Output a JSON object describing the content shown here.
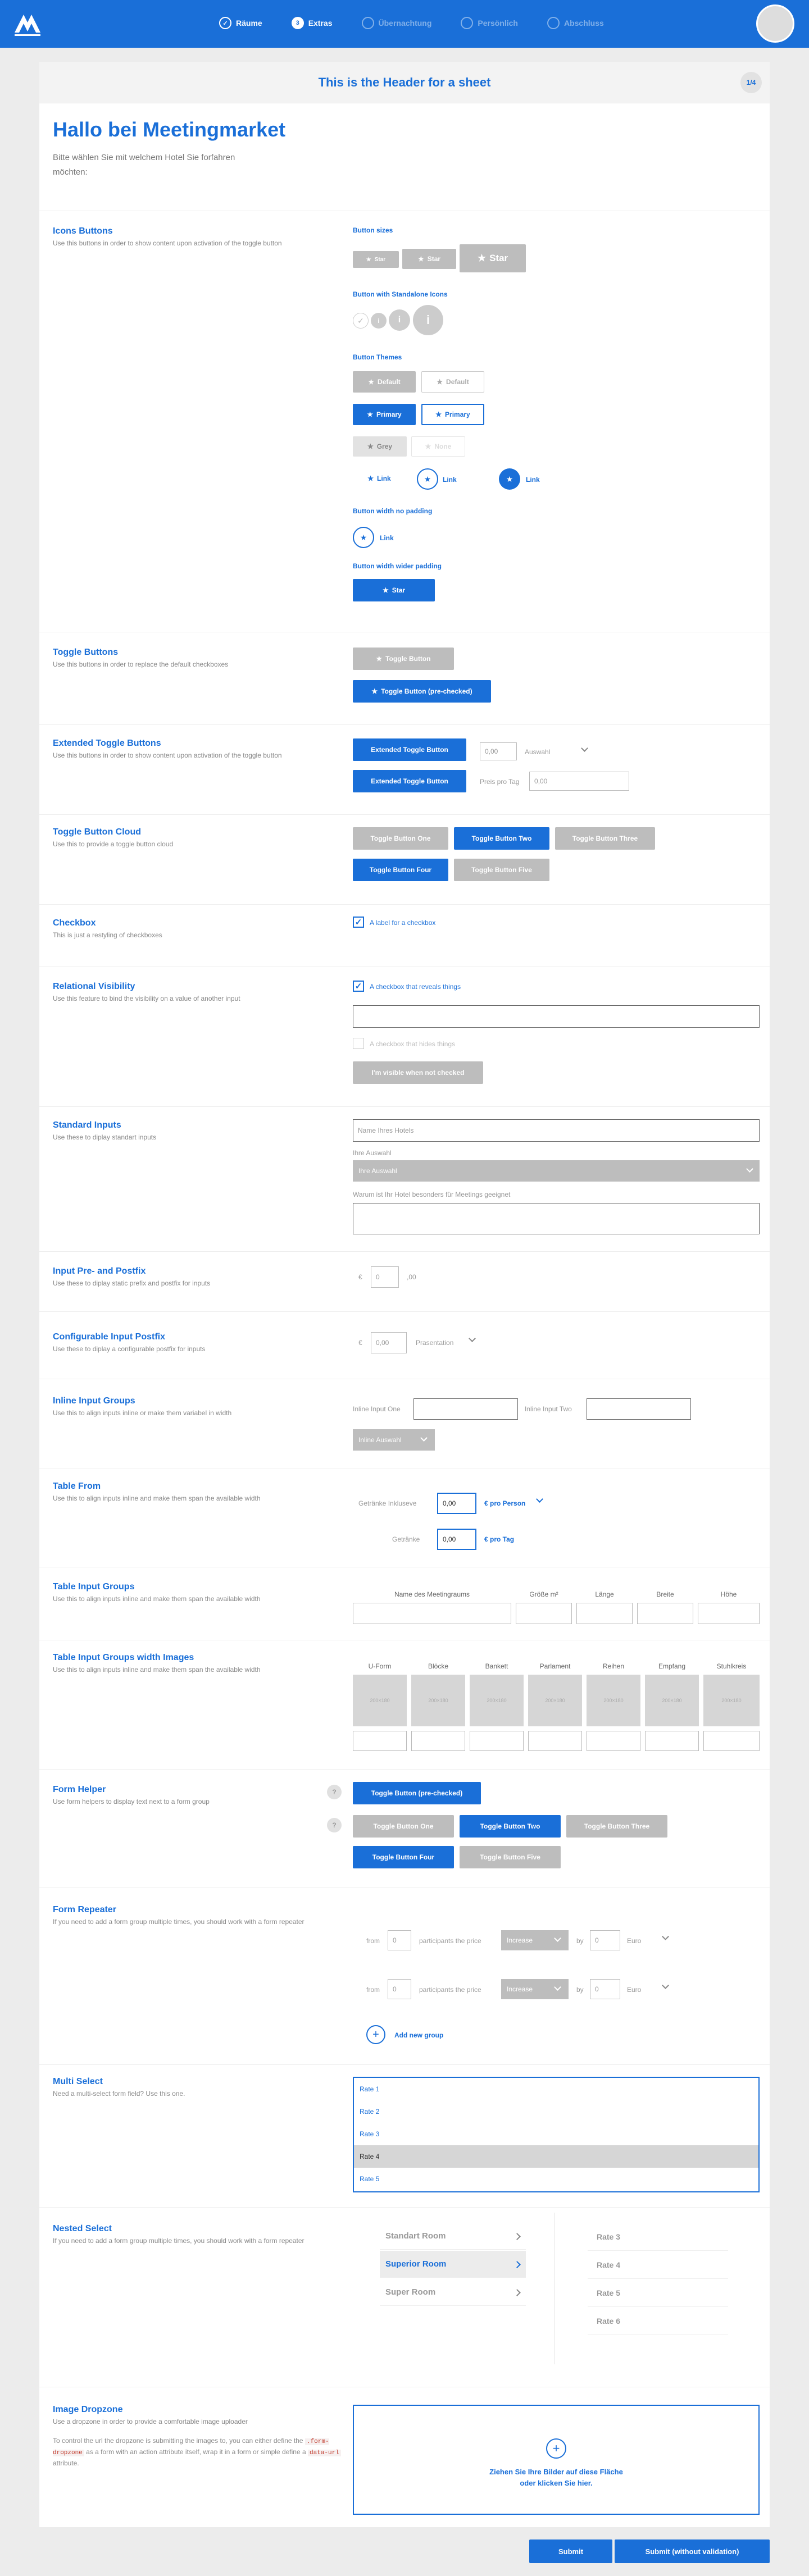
{
  "nav": {
    "steps": [
      {
        "label": "Räume",
        "state": "done"
      },
      {
        "label": "Extras",
        "state": "active",
        "number": "3"
      },
      {
        "label": "Übernachtung",
        "state": "inactive"
      },
      {
        "label": "Persönlich",
        "state": "inactive"
      },
      {
        "label": "Abschluss",
        "state": "inactive"
      }
    ]
  },
  "sheet": {
    "title": "This is the Header for a sheet",
    "pager": "1/4"
  },
  "intro": {
    "title": "Hallo bei Meetingmarket",
    "subtitle": "Bitte wählen Sie mit welchem Hotel Sie forfahren möchten:"
  },
  "icon_buttons": {
    "title": "Icons Buttons",
    "desc": "Use this buttons in order to show content upon activation of the toggle button",
    "sizes_label": "Button sizes",
    "size_small": "Star",
    "size_medium": "Star",
    "size_large": "Star",
    "standalone_label": "Button with Standalone Icons",
    "themes_label": "Button Themes",
    "default": "Default",
    "primary": "Primary",
    "grey": "Grey",
    "none": "None",
    "link": "Link",
    "nopad_label": "Button width no padding",
    "widerpad_label": "Button width wider padding",
    "star": "Star"
  },
  "toggle_buttons": {
    "title": "Toggle Buttons",
    "desc": "Use this buttons in order to replace the default checkboxes",
    "toggle": "Toggle Button",
    "toggle_checked": "Toggle Button (pre-checked)"
  },
  "extended_toggle": {
    "title": "Extended Toggle Buttons",
    "desc": "Use this buttons in order to show content upon activation of the toggle button",
    "btn": "Extended Toggle Button",
    "value": "0,00",
    "select": "Auswahl",
    "price_label": "Preis pro Tag",
    "price_value": "0,00"
  },
  "toggle_cloud": {
    "title": "Toggle Button Cloud",
    "desc": "Use this to provide a toggle button cloud",
    "buttons": [
      "Toggle Button One",
      "Toggle Button Two",
      "Toggle Button Three",
      "Toggle Button Four",
      "Toggle Button Five"
    ]
  },
  "checkbox": {
    "title": "Checkbox",
    "desc": "This is just a restyling of checkboxes",
    "label": "A label for a checkbox"
  },
  "relational": {
    "title": "Relational Visibility",
    "desc": "Use this feature to bind the visibility on a value of another input",
    "reveal": "A checkbox that reveals things",
    "hides": "A checkbox that hides things",
    "visible_btn": "I'm visible when not checked"
  },
  "standard_inputs": {
    "title": "Standard Inputs",
    "desc": "Use these to diplay standart inputs",
    "placeholder": "Name Ihres Hotels",
    "select_label": "Ihre Auswahl",
    "select_value": "Ihre Auswahl",
    "textarea_label": "Warum ist Ihr Hotel besonders für Meetings geeignet"
  },
  "pre_postfix": {
    "title": "Input Pre- and Postfix",
    "desc": "Use these to diplay static prefix and postfix for inputs",
    "prefix": "€",
    "value": "0",
    "postfix": ",00"
  },
  "config_postfix": {
    "title": "Configurable Input Postfix",
    "desc": "Use these to diplay a configurable postfix for inputs",
    "prefix": "€",
    "value": "0,00",
    "postfix": "Prasentation"
  },
  "inline_groups": {
    "title": "Inline Input Groups",
    "desc": "Use this to align inputs inline or make them variabel in width",
    "label1": "Inline Input One",
    "label2": "Inline Input Two",
    "select": "Inline Auswahl"
  },
  "table_form": {
    "title": "Table From",
    "desc": "Use this to align inputs inline and make them span the available width",
    "row1_label": "Getränke Inkluseve",
    "row1_value": "0,00",
    "row1_unit": "€ pro Person",
    "row2_label": "Getränke",
    "row2_value": "0,00",
    "row2_unit": "€ pro Tag"
  },
  "table_groups": {
    "title": "Table Input Groups",
    "desc": "Use this to align inputs inline and make them span the available width",
    "headers": [
      "Name des Meetingraums",
      "Größe m²",
      "Länge",
      "Breite",
      "Höhe"
    ]
  },
  "table_images": {
    "title": "Table Input Groups width Images",
    "desc": "Use this to align inputs inline and make them span the available width",
    "headers": [
      "U-Form",
      "Blöcke",
      "Bankett",
      "Parlament",
      "Reihen",
      "Empfang",
      "Stuhlkreis"
    ],
    "thumb": "200×180"
  },
  "form_helper": {
    "title": "Form Helper",
    "desc": "Use form helpers to display text next to a form group",
    "checked": "Toggle Button (pre-checked)",
    "help": "?"
  },
  "repeater": {
    "title": "Form Repeater",
    "desc": "If you need to add a form group multiple times, you should work with a form repeater",
    "from": "from",
    "value": "0",
    "participants": "participants the price",
    "select": "Increase",
    "by": "by",
    "by_value": "0",
    "unit": "Euro",
    "add": "Add new group"
  },
  "multi_select": {
    "title": "Multi Select",
    "desc": "Need a multi-select form field? Use this one.",
    "options": [
      "Rate 1",
      "Rate 2",
      "Rate 3",
      "Rate 4",
      "Rate 5"
    ]
  },
  "nested_select": {
    "title": "Nested Select",
    "desc": "If you need to add a form group multiple times, you should work with a form repeater",
    "left": [
      "Standart Room",
      "Superior Room",
      "Super Room"
    ],
    "right": [
      "Rate 3",
      "Rate 4",
      "Rate 5",
      "Rate 6"
    ]
  },
  "dropzone": {
    "title": "Image Dropzone",
    "desc": "Use a dropzone in order to provide a comfortable image uploader",
    "desc2a": "To control the url the dropzone is submitting the images to, you can either define the",
    "code1": ".form-dropzone",
    "desc2b": "as a form with an action attribute itself, wrap it in a form or simple define a",
    "code2": "data-url",
    "desc2c": "attribute.",
    "text1": "Ziehen Sie Ihre Bilder auf diese Fläche",
    "text2": "oder klicken Sie hier."
  },
  "footer": {
    "submit": "Submit",
    "submit_novalid": "Submit (without validation)"
  },
  "colors": {
    "primary": "#1a6fd8",
    "grey": "#bdbdbd"
  }
}
